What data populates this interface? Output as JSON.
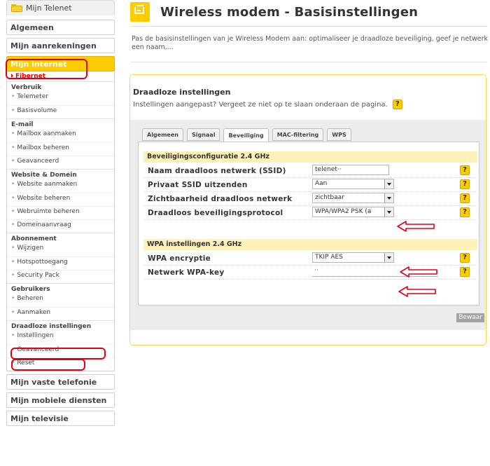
{
  "sidebar": {
    "top_tab": "Mijn Telenet",
    "algemeen": "Algemeen",
    "aanrekeningen": "Mijn aanrekeningen",
    "internet": "Mijn internet",
    "current": "Fibernet",
    "groups": [
      {
        "head": "Verbruik",
        "items": [
          "Telemeter",
          "Basisvolume"
        ]
      },
      {
        "head": "E-mail",
        "items": [
          "Mailbox aanmaken",
          "Mailbox beheren",
          "Geavanceerd"
        ]
      },
      {
        "head": "Website & Domein",
        "items": [
          "Website aanmaken",
          "Website beheren",
          "Webruimte beheren",
          "Domeinaanvraag"
        ]
      },
      {
        "head": "Abonnement",
        "items": [
          "Wijzigen",
          "Hotspottoegang",
          "Security Pack"
        ]
      },
      {
        "head": "Gebruikers",
        "items": [
          "Beheren",
          "Aanmaken"
        ]
      },
      {
        "head": "Draadloze instellingen",
        "items": [
          "Instellingen",
          "Geavanceerd",
          "Reset"
        ]
      }
    ],
    "vaste": "Mijn vaste telefonie",
    "mobiele": "Mijn mobiele diensten",
    "televisie": "Mijn televisie"
  },
  "header": {
    "title": "Wireless modem - Basisinstellingen",
    "intro": "Pas de basisinstellingen van je Wireless Modem aan: optimaliseer je draadloze beveiliging, geef je netwerk een naam,..."
  },
  "panel": {
    "title": "Draadloze instellingen",
    "subtitle": "Instellingen aangepast? Vergeet ze niet op te slaan onderaan de pagina.",
    "help_glyph": "?",
    "tabs": [
      "Algemeen",
      "Signaal",
      "Beveiliging",
      "MAC-filtering",
      "WPS"
    ],
    "active_tab": "Beveiliging",
    "section1": {
      "head": "Beveiligingsconfiguratie 2.4 GHz",
      "rows": [
        {
          "label": "Naam draadloos netwerk (SSID)",
          "value": "telenet··"
        },
        {
          "label": "Privaat SSID uitzenden",
          "value": "Aan"
        },
        {
          "label": "Zichtbaarheid draadloos netwerk",
          "value": "zichtbaar"
        },
        {
          "label": "Draadloos beveiligingsprotocol",
          "value": "WPA/WPA2 PSK (a"
        }
      ]
    },
    "section2": {
      "head": "WPA instellingen 2.4 GHz",
      "rows": [
        {
          "label": "WPA encryptie",
          "value": "TKIP AES"
        },
        {
          "label": "Netwerk WPA-key",
          "value": "··"
        }
      ]
    },
    "save": "Bewaar"
  },
  "colors": {
    "accent": "#ffcc00",
    "annotation_red": "#e0001a",
    "section_bg": "#fff2b8"
  }
}
